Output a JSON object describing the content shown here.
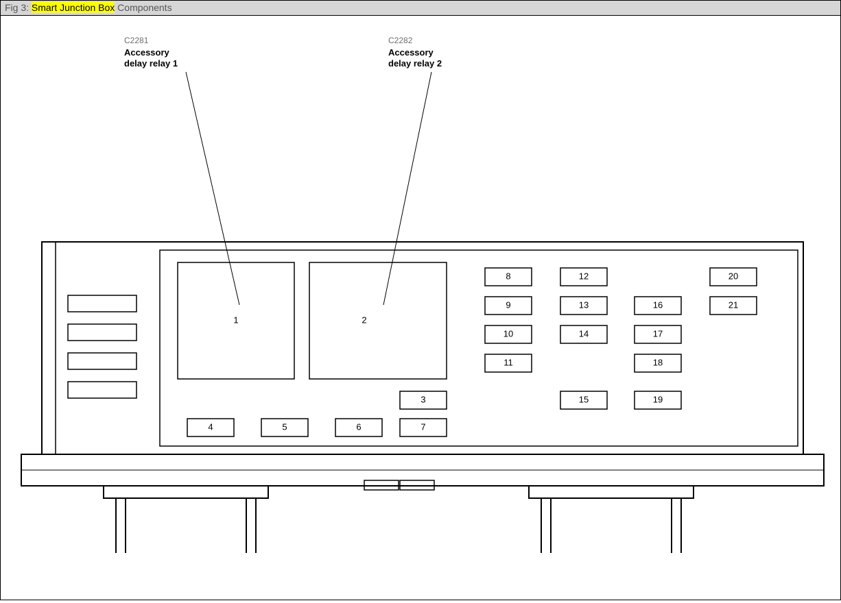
{
  "title": {
    "prefix": "Fig 3: ",
    "highlight": "Smart Junction Box",
    "suffix": " Components"
  },
  "labels": {
    "relay1": {
      "code": "C2281",
      "line1": "Accessory",
      "line2": "delay relay 1"
    },
    "relay2": {
      "code": "C2282",
      "line1": "Accessory",
      "line2": "delay relay 2"
    }
  },
  "slots": {
    "s1": "1",
    "s2": "2",
    "s3": "3",
    "s4": "4",
    "s5": "5",
    "s6": "6",
    "s7": "7",
    "s8": "8",
    "s9": "9",
    "s10": "10",
    "s11": "11",
    "s12": "12",
    "s13": "13",
    "s14": "14",
    "s15": "15",
    "s16": "16",
    "s17": "17",
    "s18": "18",
    "s19": "19",
    "s20": "20",
    "s21": "21"
  }
}
